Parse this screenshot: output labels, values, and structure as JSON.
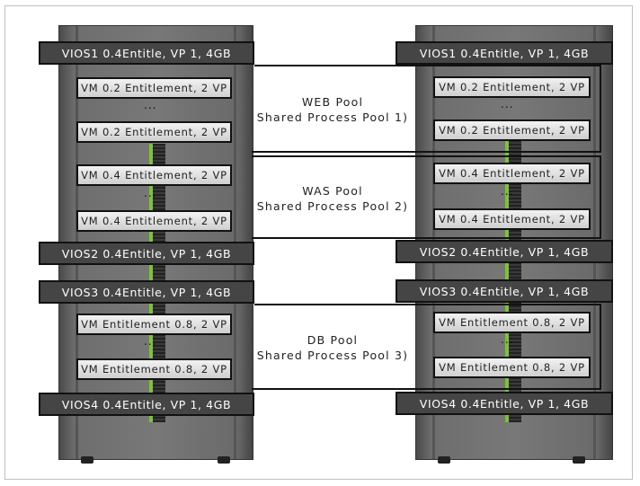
{
  "servers": [
    {
      "vios": [
        "VIOS1 0.4Entitle, VP 1, 4GB",
        "VIOS2 0.4Entitle, VP 1, 4GB",
        "VIOS3 0.4Entitle, VP 1, 4GB",
        "VIOS4 0.4Entitle, VP 1, 4GB"
      ],
      "vms": [
        "VM 0.2 Entitlement, 2 VP",
        "VM 0.2 Entitlement, 2 VP",
        "VM 0.4 Entitlement, 2 VP",
        "VM 0.4 Entitlement, 2 VP",
        "VM Entitlement 0.8, 2 VP",
        "VM Entitlement 0.8, 2 VP"
      ]
    },
    {
      "vios": [
        "VIOS1 0.4Entitle, VP 1, 4GB",
        "VIOS2 0.4Entitle, VP 1, 4GB",
        "VIOS3 0.4Entitle, VP 1, 4GB",
        "VIOS4 0.4Entitle, VP 1, 4GB"
      ],
      "vms": [
        "VM 0.2 Entitlement, 2 VP",
        "VM 0.2 Entitlement, 2 VP",
        "VM 0.4 Entitlement, 2 VP",
        "VM 0.4 Entitlement, 2 VP",
        "VM Entitlement 0.8, 2 VP",
        "VM Entitlement 0.8, 2 VP"
      ]
    }
  ],
  "ellipsis": "...",
  "pools": [
    {
      "name": "WEB Pool",
      "sub": "Shared Process Pool 1)"
    },
    {
      "name": "WAS Pool",
      "sub": "Shared Process Pool 2)"
    },
    {
      "name": "DB Pool",
      "sub": "Shared Process Pool 3)"
    }
  ]
}
